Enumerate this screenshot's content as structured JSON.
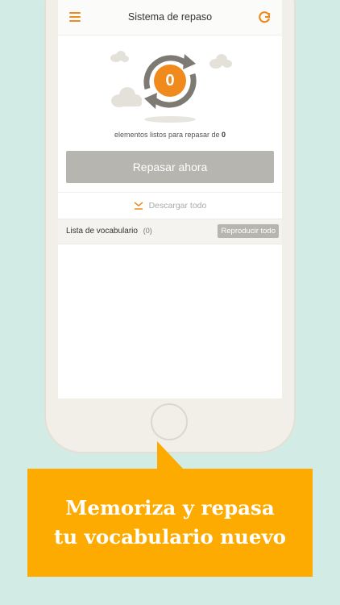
{
  "navbar": {
    "title": "Sistema de repaso",
    "menu_icon": "hamburger-icon",
    "refresh_icon": "refresh-icon"
  },
  "review": {
    "count": "0",
    "ready_text": "elementos listos para repasar de",
    "ready_total": "0",
    "button_label": "Repasar ahora"
  },
  "download": {
    "label": "Descargar todo",
    "icon": "download-icon"
  },
  "vocab": {
    "label": "Lista de vocabulario",
    "count": "(0)",
    "play_all_label": "Reproducir todo"
  },
  "banner": {
    "line1": "Memoriza y repasa",
    "line2": "tu vocabulario nuevo"
  },
  "colors": {
    "accent": "#f08a1c",
    "banner": "#fdab00",
    "background": "#d3ebe5",
    "button_gray": "#b7b5b0"
  }
}
